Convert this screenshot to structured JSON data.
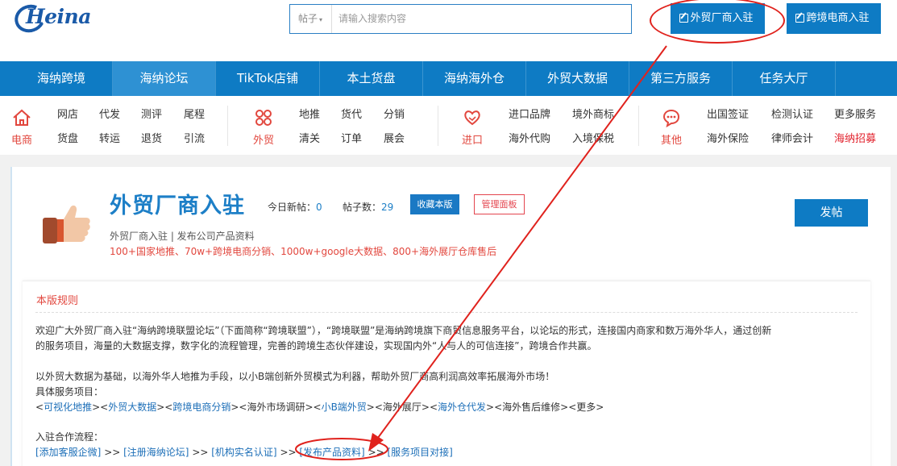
{
  "brand": {
    "logo_text": "Heina"
  },
  "search": {
    "scope": "帖子",
    "placeholder": "请输入搜索内容"
  },
  "header_buttons": {
    "foreign_trade": "外贸厂商入驻",
    "cross_border": "跨境电商入驻"
  },
  "nav": [
    {
      "label": "海纳跨境"
    },
    {
      "label": "海纳论坛",
      "active": true
    },
    {
      "label": "TikTok店铺"
    },
    {
      "label": "本土货盘"
    },
    {
      "label": "海纳海外仓"
    },
    {
      "label": "外贸大数据"
    },
    {
      "label": "第三方服务"
    },
    {
      "label": "任务大厅"
    }
  ],
  "categories": {
    "ecommerce": {
      "label": "电商",
      "links": [
        "网店",
        "代发",
        "测评",
        "尾程",
        "货盘",
        "转运",
        "退货",
        "引流"
      ]
    },
    "trade": {
      "label": "外贸",
      "links": [
        "地推",
        "货代",
        "分销",
        "清关",
        "订单",
        "展会"
      ]
    },
    "import": {
      "label": "进口",
      "links": [
        "进口品牌",
        "境外商标",
        "海外代购",
        "入境保税"
      ]
    },
    "other": {
      "label": "其他",
      "links": [
        "出国签证",
        "检测认证",
        "更多服务",
        "海外保险",
        "律师会计",
        "海纳招募"
      ]
    }
  },
  "forum": {
    "title": "外贸厂商入驻",
    "today_label": "今日新帖：",
    "today_count": "0",
    "posts_label": "帖子数：",
    "posts_count": "29",
    "fav_button": "收藏本版",
    "admin_button": "管理面板",
    "post_button": "发帖",
    "desc": "外贸厂商入驻 | 发布公司产品资料",
    "highlights": "100+国家地推、70w+跨境电商分销、1000w+google大数据、800+海外展厅仓库售后"
  },
  "rules": {
    "title": "本版规则",
    "p1_line1": "欢迎广大外贸厂商入驻“海纳跨境联盟论坛”（下面简称“跨境联盟”），“跨境联盟”是海纳跨境旗下商贸信息服务平台，以论坛的形式，连接国内商家和数万海外华人，通过创新",
    "p1_line2": "的服务项目，海量的大数据支撑，数字化的流程管理，完善的跨境生态伙伴建设，实现国内外“人与人的可信连接”，跨境合作共赢。",
    "p2_line1": "以外贸大数据为基础，以海外华人地推为手段，以小B端创新外贸模式为利器，帮助外贸厂商高利润高效率拓展海外市场！",
    "services_label": "具体服务项目：",
    "services": [
      {
        "text": "可视化地推",
        "link": true
      },
      {
        "text": "外贸大数据",
        "link": true
      },
      {
        "text": "跨境电商分销",
        "link": true
      },
      {
        "text": "海外市场调研",
        "link": false
      },
      {
        "text": "小B端外贸",
        "link": true
      },
      {
        "text": "海外展厅",
        "link": false
      },
      {
        "text": "海外仓代发",
        "link": true
      },
      {
        "text": "海外售后维修",
        "link": false
      },
      {
        "text": "更多",
        "link": false
      }
    ],
    "process_label": "入驻合作流程：",
    "process": [
      "[添加客服企微]",
      "[注册海纳论坛]",
      "[机构实名认证]",
      "[发布产品资料]",
      "[服务项目对接]"
    ]
  },
  "colors": {
    "primary": "#0e7bc4",
    "accent_red": "#e2473e",
    "annotation_red": "#e0221d"
  }
}
